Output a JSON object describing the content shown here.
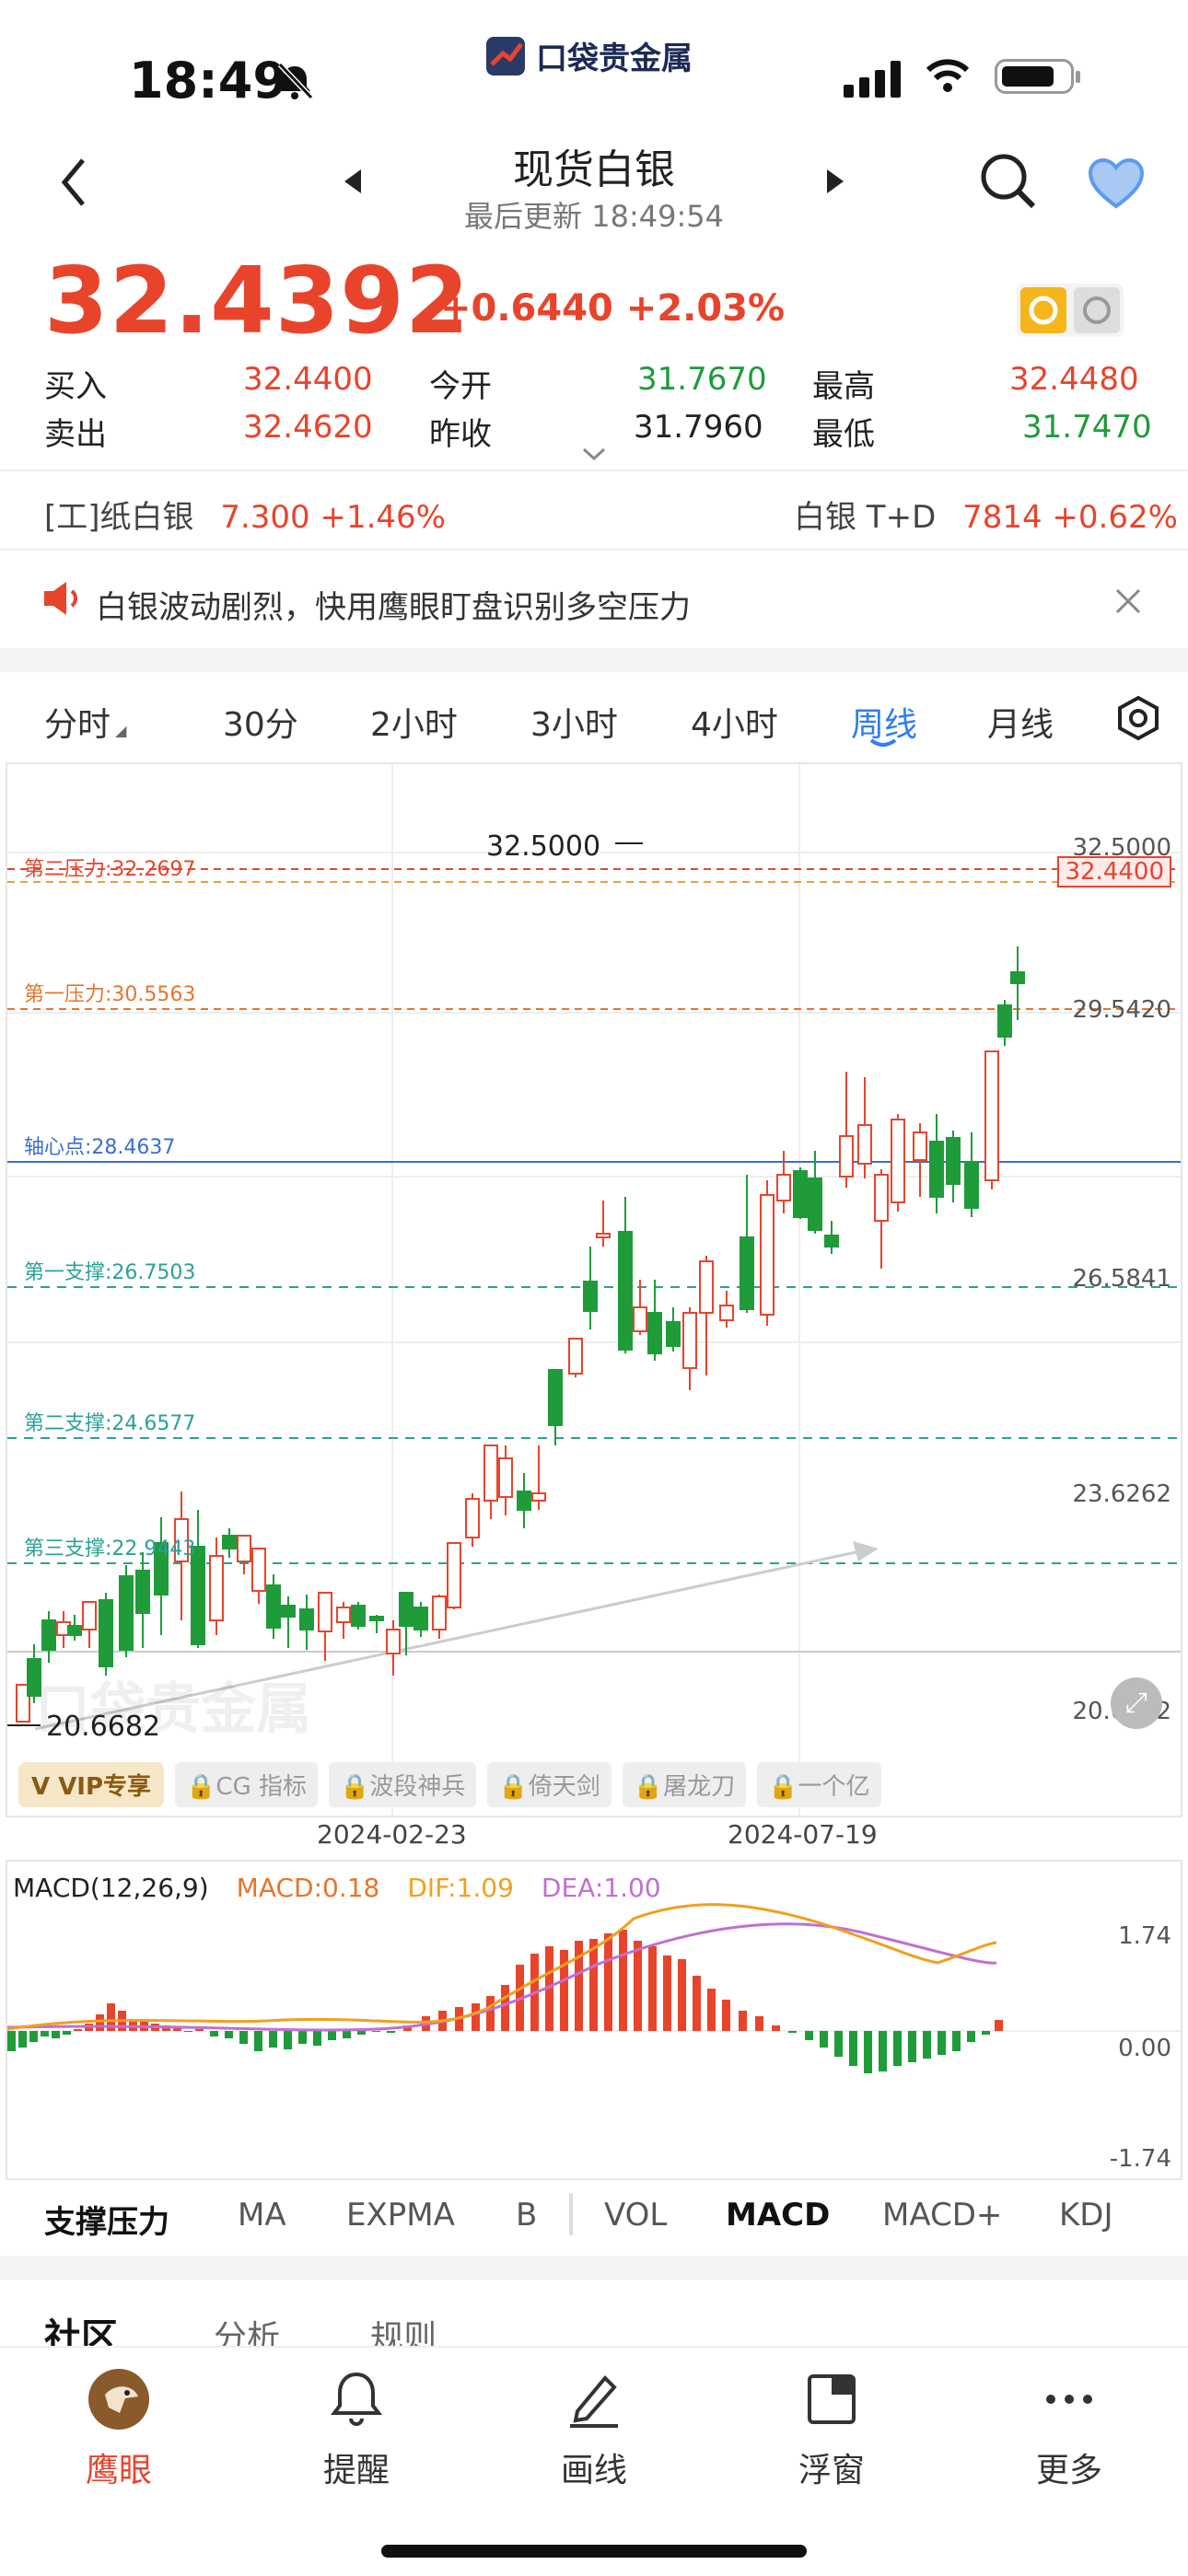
{
  "status": {
    "time": "18:49"
  },
  "app_logo_text": "口袋贵金属",
  "header": {
    "title": "现货白银",
    "updated": "最后更新 18:49:54"
  },
  "quote": {
    "price": "32.4392",
    "change": "+0.6440 +2.03%",
    "bid_label": "买入",
    "bid": "32.4400",
    "ask_label": "卖出",
    "ask": "32.4620",
    "open_label": "今开",
    "open": "31.7670",
    "prev_label": "昨收",
    "prev": "31.7960",
    "high_label": "最高",
    "high": "32.4480",
    "low_label": "最低",
    "low": "31.7470"
  },
  "related": [
    {
      "name": "[工]纸白银",
      "value": "7.300 +1.46%"
    },
    {
      "name": "白银 T+D",
      "value": "7814 +0.62%"
    }
  ],
  "notice": {
    "text": "白银波动剧烈，快用鹰眼盯盘识别多空压力"
  },
  "periods": [
    "分时",
    "30分",
    "2小时",
    "3小时",
    "4小时",
    "周线",
    "月线"
  ],
  "active_period": "周线",
  "chart": {
    "levels": [
      {
        "label": "第二压力:32.2697",
        "color": "#e8442c"
      },
      {
        "label": "第一压力:30.5563",
        "color": "#e8742c"
      },
      {
        "label": "轴心点:28.4637",
        "color": "#3b6fc9"
      },
      {
        "label": "第一支撑:26.7503",
        "color": "#2aa198"
      },
      {
        "label": "第二支撑:24.6577",
        "color": "#2aa198"
      },
      {
        "label": "第三支撑:22.9443",
        "color": "#2aa198"
      }
    ],
    "price_ticks": [
      "32.5000",
      "29.5420",
      "26.5841",
      "23.6262",
      "20.6682"
    ],
    "current_price_tag": "32.4400",
    "max_label": "32.5000",
    "min_label": "20.6682",
    "dates": [
      "2024-02-23",
      "2024-07-19"
    ],
    "watermark": "口袋贵金属",
    "vip_label": "VIP专享",
    "tags": [
      "CG 指标",
      "波段神兵",
      "倚天剑",
      "屠龙刀",
      "一个亿"
    ]
  },
  "macd": {
    "title": "MACD(12,26,9)",
    "macd": "MACD:0.18",
    "dif": "DIF:1.09",
    "dea": "DEA:1.00",
    "ticks": [
      "1.74",
      "0.00",
      "-1.74"
    ],
    "colors": {
      "dif": "#f0a020",
      "dea": "#c070d0",
      "up": "#e8442c",
      "down": "#1f9b3a"
    }
  },
  "indicator_tabs": [
    "支撑压力",
    "MA",
    "EXPMA",
    "B",
    "VOL",
    "MACD",
    "MACD+",
    "KDJ"
  ],
  "active_indicator": "MACD",
  "bottom_tabs": [
    "社区",
    "分析",
    "规则"
  ],
  "nav": [
    {
      "label": "鹰眼",
      "icon": "eagle-icon"
    },
    {
      "label": "提醒",
      "icon": "bell-icon"
    },
    {
      "label": "画线",
      "icon": "pen-icon"
    },
    {
      "label": "浮窗",
      "icon": "float-window-icon"
    },
    {
      "label": "更多",
      "icon": "more-icon"
    }
  ]
}
